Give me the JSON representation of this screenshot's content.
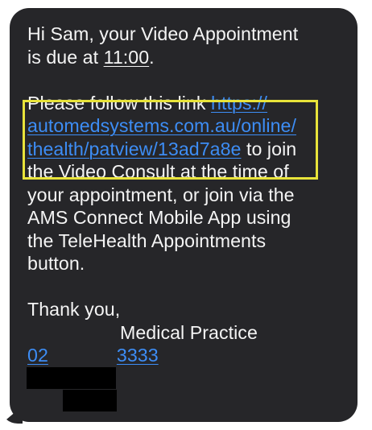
{
  "message": {
    "line1a": "Hi Sam, your Video Appointment",
    "line2a": "is due at ",
    "time": "11:00",
    "line2b": ".",
    "p2_line1_text": "Please follow this link ",
    "p2_line1_link": "https://",
    "p2_line2_link": "automedsystems.com.au/online/",
    "p2_line3_link": "thealth/patview/13ad7a8e",
    "p2_line3_text": " to join",
    "p2_line4": "the Video Consult at the time of",
    "p2_line5": "your appointment, or join via the",
    "p2_line6": "AMS Connect Mobile App using",
    "p2_line7": "the TeleHealth Appointments",
    "p2_line8": "button.",
    "p3_line1": "Thank you,",
    "practice_suffix": "Medical Practice",
    "phone_prefix": "02",
    "phone_suffix": "3333"
  },
  "colors": {
    "bubble": "#262629",
    "text": "#f4f4f4",
    "link": "#3d8df5",
    "highlight": "#e8e33a",
    "redaction": "#000000"
  }
}
